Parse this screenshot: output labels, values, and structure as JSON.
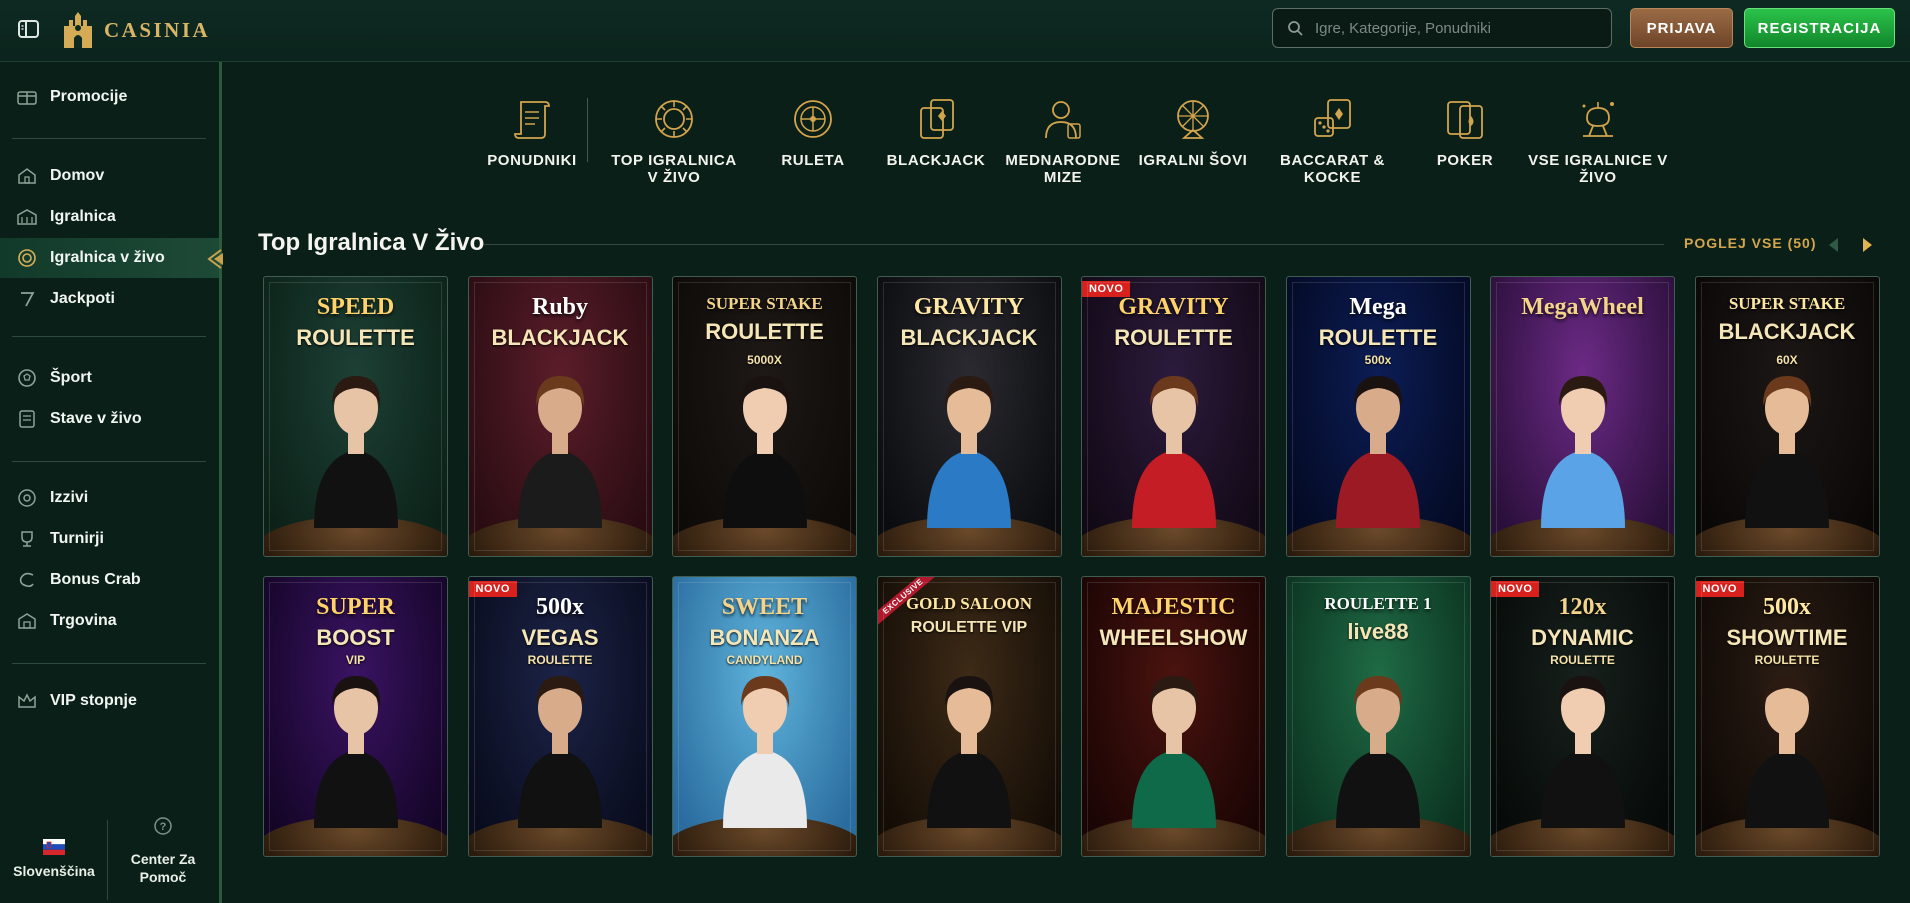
{
  "header": {
    "logo_text": "CASINIA",
    "search_placeholder": "Igre, Kategorije, Ponudniki",
    "login_label": "PRIJAVA",
    "register_label": "REGISTRACIJA"
  },
  "sidebar": {
    "items": [
      {
        "label": "Promocije",
        "icon": "gift-icon"
      },
      {
        "label": "Domov",
        "icon": "house-icon"
      },
      {
        "label": "Igralnica",
        "icon": "casino-building-icon"
      },
      {
        "label": "Igralnica v živo",
        "icon": "roulette-chip-icon"
      },
      {
        "label": "Jackpoti",
        "icon": "seven-icon"
      },
      {
        "label": "Šport",
        "icon": "football-icon"
      },
      {
        "label": "Stave v živo",
        "icon": "live-bet-icon"
      },
      {
        "label": "Izzivi",
        "icon": "target-icon"
      },
      {
        "label": "Turnirji",
        "icon": "trophy-icon"
      },
      {
        "label": "Bonus Crab",
        "icon": "crab-icon"
      },
      {
        "label": "Trgovina",
        "icon": "shop-icon"
      },
      {
        "label": "VIP stopnje",
        "icon": "crown-icon"
      }
    ],
    "active": "Igralnica v živo",
    "language_label": "Slovenščina",
    "help_label": "Center Za Pomoč"
  },
  "categories": [
    {
      "label": "PONUDNIKI",
      "icon": "scroll-icon"
    },
    {
      "label": "TOP IGRALNICA V ŽIVO",
      "icon": "chip-icon"
    },
    {
      "label": "RULETA",
      "icon": "roulette-wheel-icon"
    },
    {
      "label": "BLACKJACK",
      "icon": "cards-icon"
    },
    {
      "label": "MEDNARODNE MIZE",
      "icon": "dealer-icon"
    },
    {
      "label": "IGRALNI ŠOVI",
      "icon": "wheel-show-icon"
    },
    {
      "label": "BACCARAT & KOCKE",
      "icon": "dice-cards-icon"
    },
    {
      "label": "POKER",
      "icon": "poker-cards-icon"
    },
    {
      "label": "VSE IGRALNICE V ŽIVO",
      "icon": "all-live-icon"
    }
  ],
  "section": {
    "title": "Top Igralnica V Živo",
    "view_all": "POGLEJ VSE (50)"
  },
  "games": [
    {
      "title": "SPEED",
      "subtitle": "ROULETTE",
      "badge": "",
      "colors": [
        "#1d4035",
        "#0c2219"
      ]
    },
    {
      "title": "Ruby",
      "subtitle": "BLACKJACK",
      "badge": "",
      "colors": [
        "#5b1d2a",
        "#2a0c12"
      ]
    },
    {
      "title": "SUPER STAKE",
      "subtitle": "ROULETTE",
      "extra": "5000X",
      "badge": "",
      "colors": [
        "#1e1916",
        "#0d0a08"
      ]
    },
    {
      "title": "GRAVITY",
      "subtitle": "BLACKJACK",
      "badge": "",
      "colors": [
        "#2a2a30",
        "#0b0c10"
      ]
    },
    {
      "title": "GRAVITY",
      "subtitle": "ROULETTE",
      "badge": "NOVO",
      "colors": [
        "#2c1b3c",
        "#120916"
      ]
    },
    {
      "title": "Mega",
      "subtitle": "ROULETTE",
      "extra": "500x",
      "badge": "",
      "colors": [
        "#0c1d55",
        "#040a24"
      ]
    },
    {
      "title": "MegaWheel",
      "subtitle": "",
      "badge": "",
      "colors": [
        "#6c2a86",
        "#2a0f3a"
      ]
    },
    {
      "title": "SUPER STAKE",
      "subtitle": "BLACKJACK",
      "extra": "60X",
      "badge": "",
      "colors": [
        "#1c1715",
        "#0a0807"
      ]
    },
    {
      "title": "SUPER",
      "subtitle": "BOOST",
      "extra": "VIP",
      "badge": "",
      "colors": [
        "#3a1363",
        "#140527"
      ]
    },
    {
      "title": "500x",
      "subtitle": "VEGAS",
      "extra": "ROULETTE",
      "badge": "NOVO",
      "colors": [
        "#1c2347",
        "#090c1d"
      ]
    },
    {
      "title": "SWEET",
      "subtitle": "BONANZA",
      "extra": "CANDYLAND",
      "badge": "",
      "colors": [
        "#5fb4dc",
        "#2a6c9e"
      ]
    },
    {
      "title": "GOLD SALOON",
      "subtitle": "ROULETTE VIP",
      "badge": "EXCLUSIVE",
      "colors": [
        "#3d2a17",
        "#140d06"
      ]
    },
    {
      "title": "MAJESTIC",
      "subtitle": "WHEELSHOW",
      "badge": "",
      "colors": [
        "#4a130f",
        "#1a0504"
      ]
    },
    {
      "title": "ROULETTE 1",
      "subtitle": "live88",
      "badge": "",
      "colors": [
        "#1f6b45",
        "#0b3220"
      ]
    },
    {
      "title": "120x",
      "subtitle": "DYNAMIC",
      "extra": "ROULETTE",
      "badge": "NOVO",
      "colors": [
        "#17201c",
        "#060a08"
      ]
    },
    {
      "title": "500x",
      "subtitle": "SHOWTIME",
      "extra": "ROULETTE",
      "badge": "NOVO",
      "colors": [
        "#2b1d14",
        "#0d0805"
      ]
    }
  ]
}
